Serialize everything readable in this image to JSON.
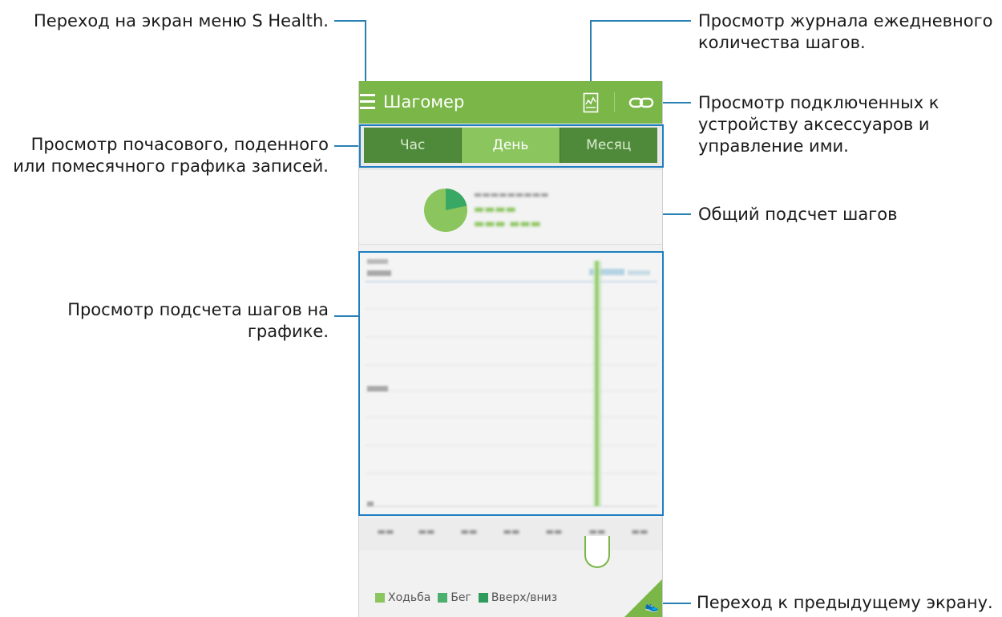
{
  "callouts": {
    "menu": "Переход на экран меню S Health.",
    "journal": [
      "Просмотр журнала ежедневного",
      "количества шагов."
    ],
    "accessories": [
      "Просмотр подключенных к",
      "устройству аксессуаров и",
      "управление ими."
    ],
    "tabs": [
      "Просмотр почасового, поденного",
      "или помесячного графика записей."
    ],
    "total": "Общий подсчет шагов",
    "graph": [
      "Просмотр подсчета шагов на",
      "графике."
    ],
    "back": "Переход к предыдущему экрану."
  },
  "app": {
    "title": "Шагомер",
    "tabs": [
      {
        "label": "Час",
        "active": false
      },
      {
        "label": "День",
        "active": true
      },
      {
        "label": "Месяц",
        "active": false
      }
    ],
    "legend": [
      {
        "label": "Ходьба",
        "color": "#8bc55e"
      },
      {
        "label": "Бег",
        "color": "#4caf6e"
      },
      {
        "label": "Вверх/вниз",
        "color": "#2e9b5a"
      }
    ],
    "icons": {
      "menu": "menu-icon",
      "journal": "chart-journal-icon",
      "accessories": "link-icon",
      "back": "shoe-icon"
    }
  },
  "colors": {
    "actionbar": "#7ab648",
    "tab_active": "#8bc55e",
    "tab_inactive": "#4f8a3a",
    "callout_line": "#2a7fb3",
    "highlight": "#1f7ec1"
  }
}
